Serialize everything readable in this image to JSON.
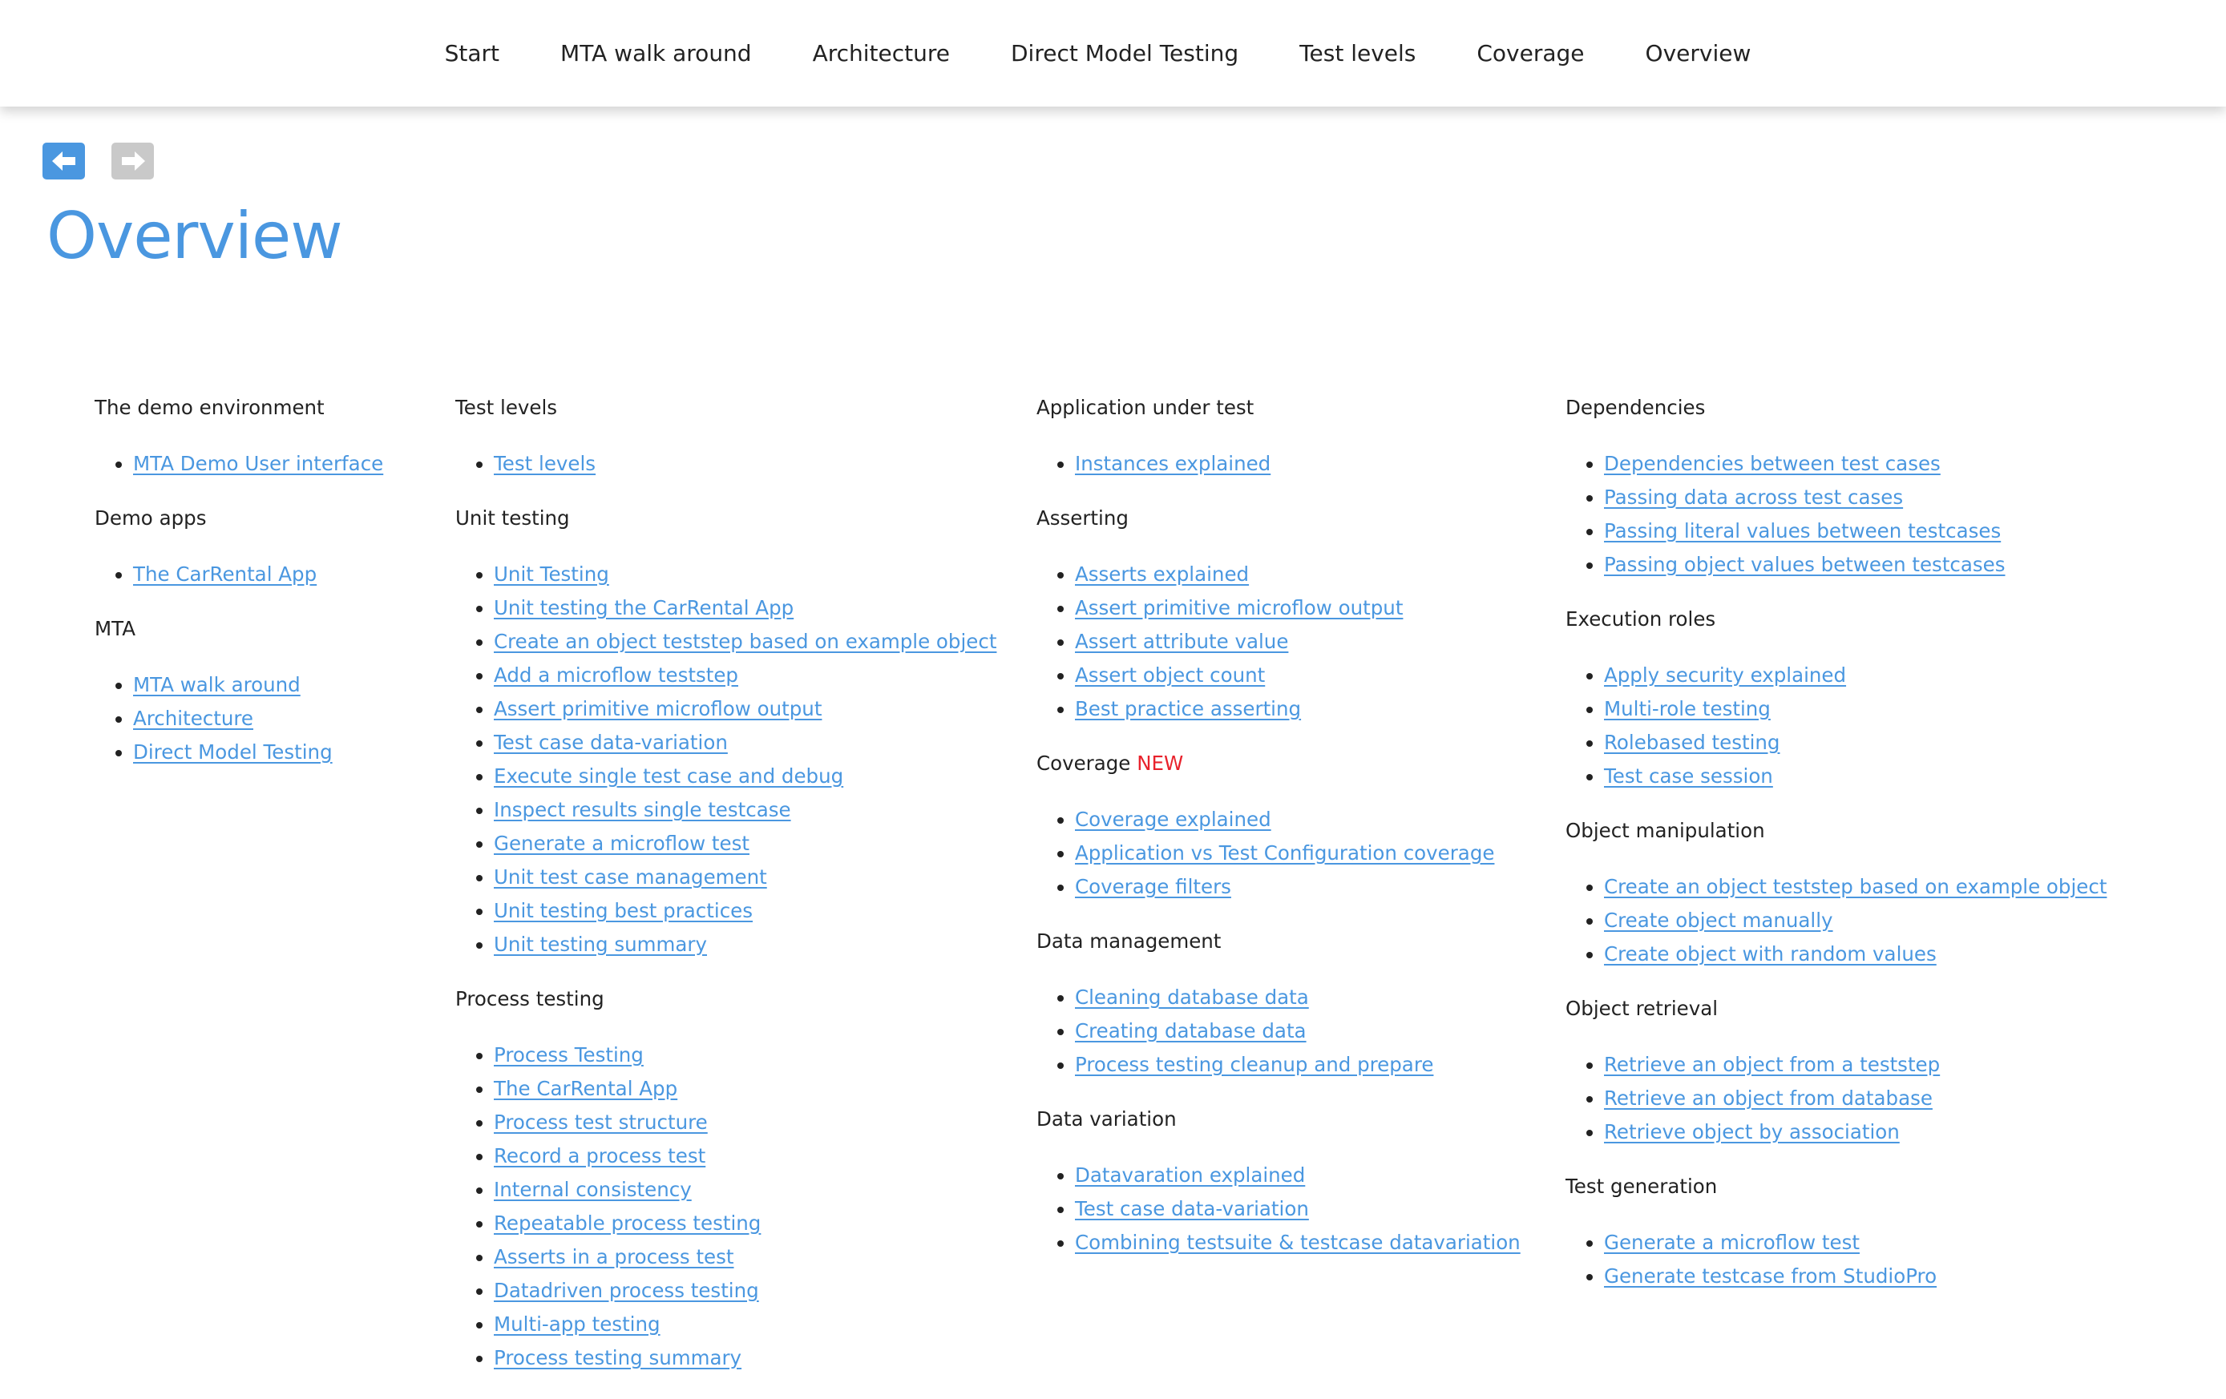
{
  "nav": {
    "items": [
      "Start",
      "MTA walk around",
      "Architecture",
      "Direct Model Testing",
      "Test levels",
      "Coverage",
      "Overview"
    ]
  },
  "page_title": "Overview",
  "columns": [
    {
      "sections": [
        {
          "heading": "The demo environment",
          "links": [
            "MTA Demo User interface"
          ]
        },
        {
          "heading": "Demo apps",
          "links": [
            "The CarRental App"
          ]
        },
        {
          "heading": "MTA",
          "links": [
            "MTA walk around",
            "Architecture",
            "Direct Model Testing"
          ]
        }
      ]
    },
    {
      "sections": [
        {
          "heading": "Test levels",
          "links": [
            "Test levels"
          ]
        },
        {
          "heading": "Unit testing",
          "links": [
            "Unit Testing",
            "Unit testing the CarRental App",
            "Create an object teststep based on example object",
            "Add a microflow teststep",
            "Assert primitive microflow output",
            "Test case data-variation",
            "Execute single test case and debug",
            "Inspect results single testcase",
            "Generate a microflow test",
            "Unit test case management",
            "Unit testing best practices",
            "Unit testing summary"
          ]
        },
        {
          "heading": "Process testing",
          "links": [
            "Process Testing",
            "The CarRental App",
            "Process test structure",
            "Record a process test",
            "Internal consistency",
            "Repeatable process testing",
            "Asserts in a process test",
            "Datadriven process testing",
            "Multi-app testing",
            "Process testing summary"
          ]
        }
      ]
    },
    {
      "sections": [
        {
          "heading": "Application under test",
          "links": [
            "Instances explained"
          ]
        },
        {
          "heading": "Asserting",
          "links": [
            "Asserts explained",
            "Assert primitive microflow output",
            "Assert attribute value",
            "Assert object count",
            "Best practice asserting"
          ]
        },
        {
          "heading": "Coverage",
          "badge": "NEW",
          "links": [
            "Coverage explained",
            "Application vs Test Configuration coverage",
            "Coverage filters"
          ]
        },
        {
          "heading": "Data management",
          "links": [
            "Cleaning database data",
            "Creating database data",
            "Process testing cleanup and prepare"
          ]
        },
        {
          "heading": "Data variation",
          "links": [
            "Datavaration explained",
            "Test case data-variation",
            "Combining testsuite & testcase datavariation"
          ]
        }
      ]
    },
    {
      "sections": [
        {
          "heading": "Dependencies",
          "links": [
            "Dependencies between test cases",
            "Passing data across test cases",
            "Passing literal values between testcases",
            "Passing object values between testcases"
          ]
        },
        {
          "heading": "Execution roles",
          "links": [
            "Apply security explained",
            "Multi-role testing",
            "Rolebased testing",
            "Test case session"
          ]
        },
        {
          "heading": "Object manipulation",
          "links": [
            "Create an object teststep based on example object",
            "Create object manually",
            "Create object with random values"
          ]
        },
        {
          "heading": "Object retrieval",
          "links": [
            "Retrieve an object from a teststep",
            "Retrieve an object from database",
            "Retrieve object by association"
          ]
        },
        {
          "heading": "Test generation",
          "links": [
            "Generate a microflow test",
            "Generate testcase from StudioPro"
          ]
        }
      ]
    }
  ],
  "icons": {
    "back": "arrow-left-icon",
    "forward": "arrow-right-icon"
  },
  "colors": {
    "accent": "#4a97e0",
    "new_badge": "#e8222c",
    "disabled": "#c9c9c9"
  }
}
